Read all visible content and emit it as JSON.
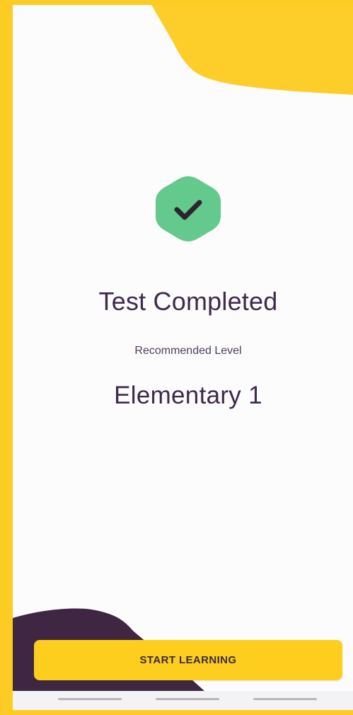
{
  "result": {
    "title": "Test Completed",
    "subtitle": "Recommended Level",
    "level": "Elementary 1",
    "status_icon": "check-icon"
  },
  "actions": {
    "start_label": "START LEARNING"
  },
  "colors": {
    "accent_yellow": "#fccc24",
    "dark_purple": "#3f2744",
    "success_green": "#63c98c",
    "text_dark": "#3e2a4c"
  }
}
